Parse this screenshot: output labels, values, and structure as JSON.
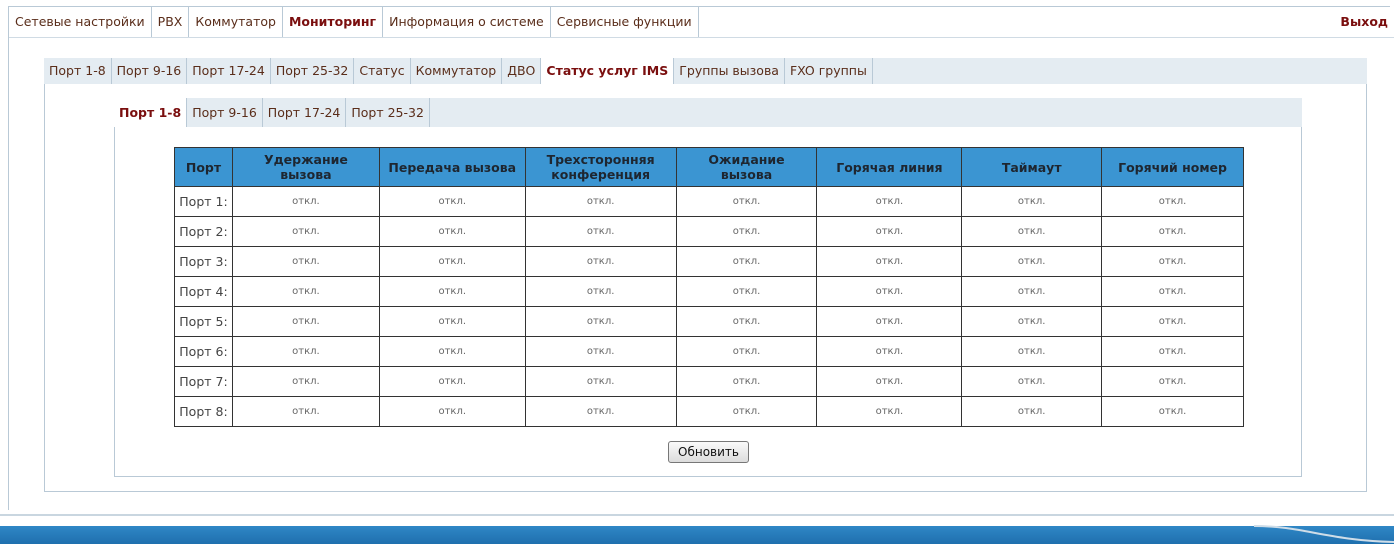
{
  "topnav": {
    "items": [
      "Сетевые настройки",
      "PBX",
      "Коммутатор",
      "Мониторинг",
      "Информация о системе",
      "Сервисные функции"
    ],
    "active_index": 3,
    "exit_label": "Выход"
  },
  "tabs_level2": {
    "items": [
      "Порт 1-8",
      "Порт 9-16",
      "Порт 17-24",
      "Порт 25-32",
      "Статус",
      "Коммутатор",
      "ДВО",
      "Статус услуг IMS",
      "Группы вызова",
      "FXO группы"
    ],
    "active_index": 7
  },
  "tabs_level3": {
    "items": [
      "Порт 1-8",
      "Порт 9-16",
      "Порт 17-24",
      "Порт 25-32"
    ],
    "active_index": 0
  },
  "table": {
    "headers": [
      "Порт",
      "Удержание вызова",
      "Передача вызова",
      "Трехсторонняя конференция",
      "Ожидание вызова",
      "Горячая линия",
      "Таймаут",
      "Горячий номер"
    ],
    "rows": [
      [
        "Порт 1:",
        "откл.",
        "откл.",
        "откл.",
        "откл.",
        "откл.",
        "откл.",
        "откл."
      ],
      [
        "Порт 2:",
        "откл.",
        "откл.",
        "откл.",
        "откл.",
        "откл.",
        "откл.",
        "откл."
      ],
      [
        "Порт 3:",
        "откл.",
        "откл.",
        "откл.",
        "откл.",
        "откл.",
        "откл.",
        "откл."
      ],
      [
        "Порт 4:",
        "откл.",
        "откл.",
        "откл.",
        "откл.",
        "откл.",
        "откл.",
        "откл."
      ],
      [
        "Порт 5:",
        "откл.",
        "откл.",
        "откл.",
        "откл.",
        "откл.",
        "откл.",
        "откл."
      ],
      [
        "Порт 6:",
        "откл.",
        "откл.",
        "откл.",
        "откл.",
        "откл.",
        "откл.",
        "откл."
      ],
      [
        "Порт 7:",
        "откл.",
        "откл.",
        "откл.",
        "откл.",
        "откл.",
        "откл.",
        "откл."
      ],
      [
        "Порт 8:",
        "откл.",
        "откл.",
        "откл.",
        "откл.",
        "откл.",
        "откл.",
        "откл."
      ]
    ]
  },
  "refresh_label": "Обновить"
}
